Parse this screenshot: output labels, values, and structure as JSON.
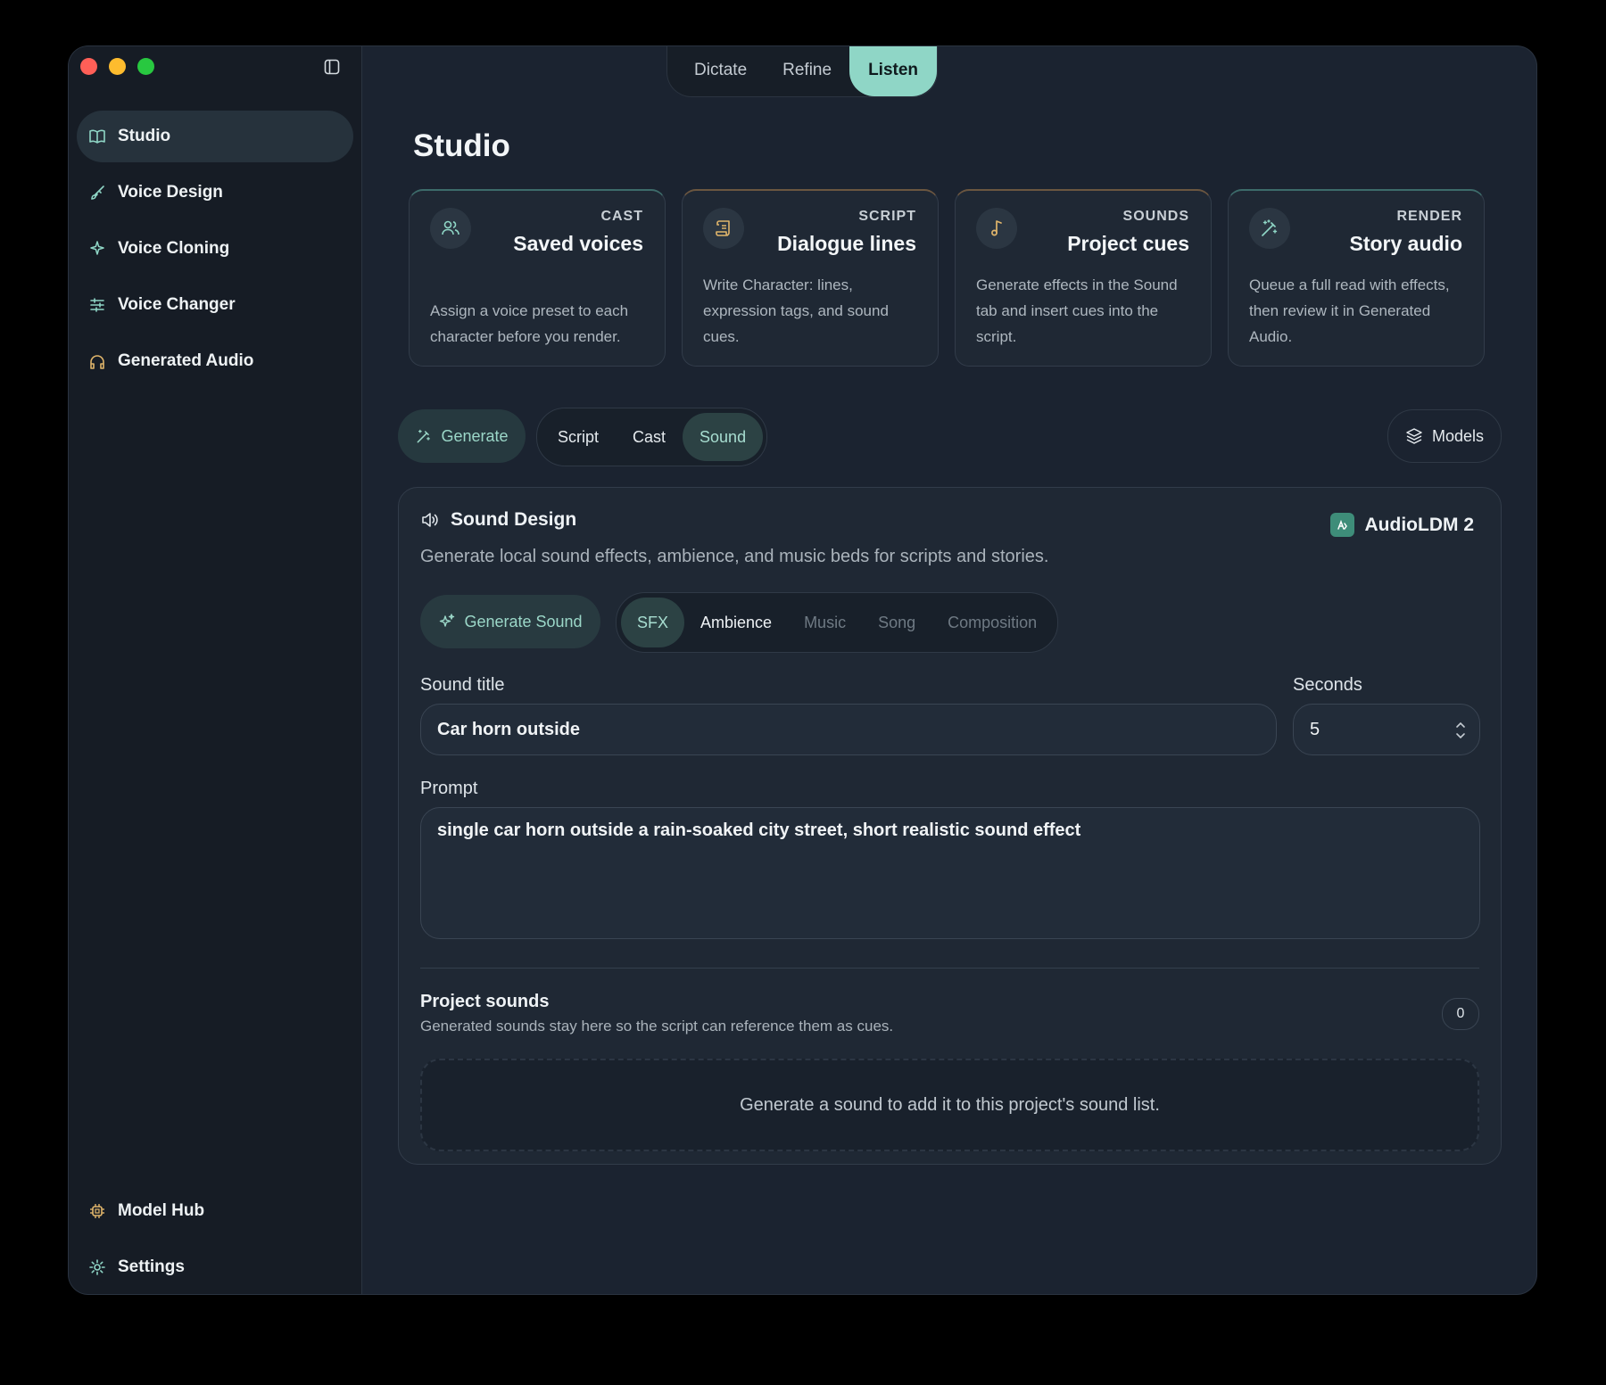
{
  "window": {
    "top_tabs": [
      "Dictate",
      "Refine",
      "Listen"
    ],
    "active_top_tab": "Listen"
  },
  "sidebar": {
    "items": [
      {
        "label": "Studio",
        "icon": "book-icon",
        "active": true
      },
      {
        "label": "Voice Design",
        "icon": "paintbrush-icon"
      },
      {
        "label": "Voice Cloning",
        "icon": "sparkle-icon"
      },
      {
        "label": "Voice Changer",
        "icon": "sliders-icon"
      },
      {
        "label": "Generated Audio",
        "icon": "headphones-icon"
      }
    ],
    "bottom_items": [
      {
        "label": "Model Hub",
        "icon": "chip-icon"
      },
      {
        "label": "Settings",
        "icon": "gear-icon"
      }
    ]
  },
  "main": {
    "title": "Studio",
    "cards": [
      {
        "kicker": "CAST",
        "title": "Saved voices",
        "desc": "Assign a voice preset to each character before you render.",
        "icon": "users-icon"
      },
      {
        "kicker": "SCRIPT",
        "title": "Dialogue lines",
        "desc": "Write Character: lines, expression tags, and sound cues.",
        "icon": "scroll-icon"
      },
      {
        "kicker": "SOUNDS",
        "title": "Project cues",
        "desc": "Generate effects in the Sound tab and insert cues into the script.",
        "icon": "music-note-icon"
      },
      {
        "kicker": "RENDER",
        "title": "Story audio",
        "desc": "Queue a full read with effects, then review it in Generated Audio.",
        "icon": "magic-wand-icon"
      }
    ],
    "generate_label": "Generate",
    "tabs": [
      "Script",
      "Cast",
      "Sound"
    ],
    "active_tab": "Sound",
    "models_label": "Models"
  },
  "sound_design": {
    "title": "Sound Design",
    "subtitle": "Generate local sound effects, ambience, and music beds for scripts and stories.",
    "model": "AudioLDM 2",
    "generate_sound_label": "Generate Sound",
    "types": [
      "SFX",
      "Ambience",
      "Music",
      "Song",
      "Composition"
    ],
    "active_type": "SFX",
    "sound_title_label": "Sound title",
    "sound_title_value": "Car horn outside",
    "seconds_label": "Seconds",
    "seconds_value": "5",
    "prompt_label": "Prompt",
    "prompt_value": "single car horn outside a rain-soaked city street, short realistic sound effect",
    "project_sounds_title": "Project sounds",
    "project_sounds_sub": "Generated sounds stay here so the script can reference them as cues.",
    "project_sounds_count": "0",
    "empty_text": "Generate a sound to add it to this project's sound list."
  }
}
